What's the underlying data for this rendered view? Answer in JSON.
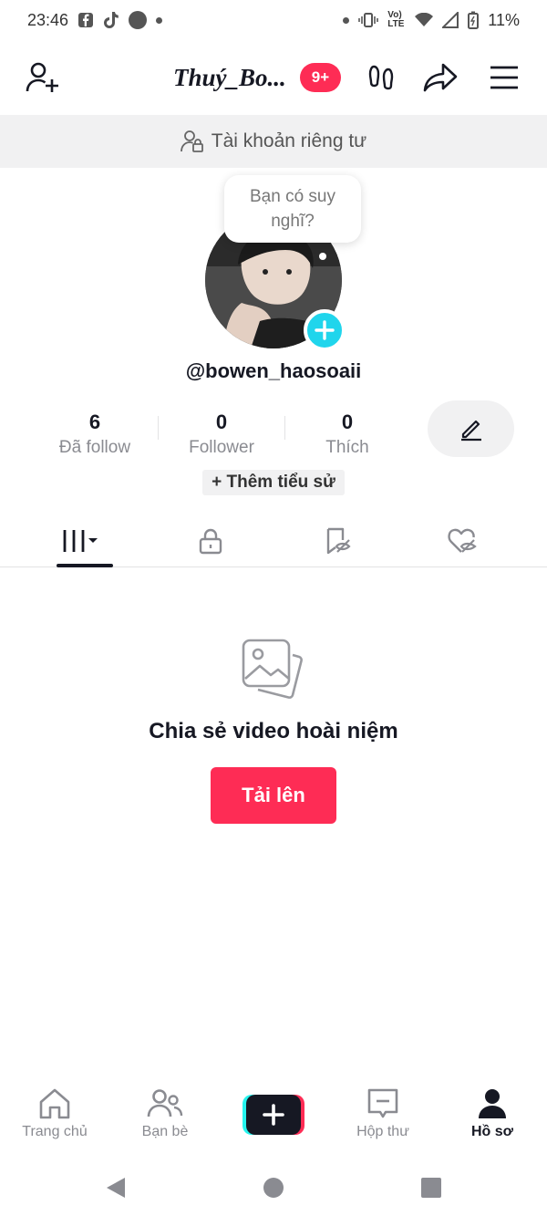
{
  "status_bar": {
    "time": "23:46",
    "network": "Vo) LTE",
    "battery": "11%"
  },
  "header": {
    "title": "Thuý_Bo...",
    "notification_count": "9+"
  },
  "banner": {
    "text": "Tài khoản riêng tư"
  },
  "profile": {
    "bubble_text": "Bạn có suy nghĩ?",
    "username": "@bowen_haosoaii",
    "stats": [
      {
        "value": "6",
        "label": "Đã follow"
      },
      {
        "value": "0",
        "label": "Follower"
      },
      {
        "value": "0",
        "label": "Thích"
      }
    ],
    "add_bio_label": "+ Thêm tiểu sử"
  },
  "tabs": [
    {
      "icon": "grid-icon",
      "active": true
    },
    {
      "icon": "lock-icon",
      "active": false
    },
    {
      "icon": "bookmark-icon",
      "active": false
    },
    {
      "icon": "heart-icon",
      "active": false
    }
  ],
  "empty_state": {
    "text": "Chia sẻ video hoài niệm",
    "button_label": "Tải lên"
  },
  "bottom_nav": [
    {
      "label": "Trang chủ",
      "icon": "home-icon",
      "active": false
    },
    {
      "label": "Bạn bè",
      "icon": "friends-icon",
      "active": false
    },
    {
      "label": "",
      "icon": "create-icon",
      "active": false
    },
    {
      "label": "Hộp thư",
      "icon": "inbox-icon",
      "active": false
    },
    {
      "label": "Hồ sơ",
      "icon": "profile-icon",
      "active": true
    }
  ],
  "colors": {
    "accent": "#fe2c55",
    "cyan": "#20d5ec",
    "text": "#161823",
    "muted": "#8a8b91",
    "banner_bg": "#f1f1f2"
  }
}
